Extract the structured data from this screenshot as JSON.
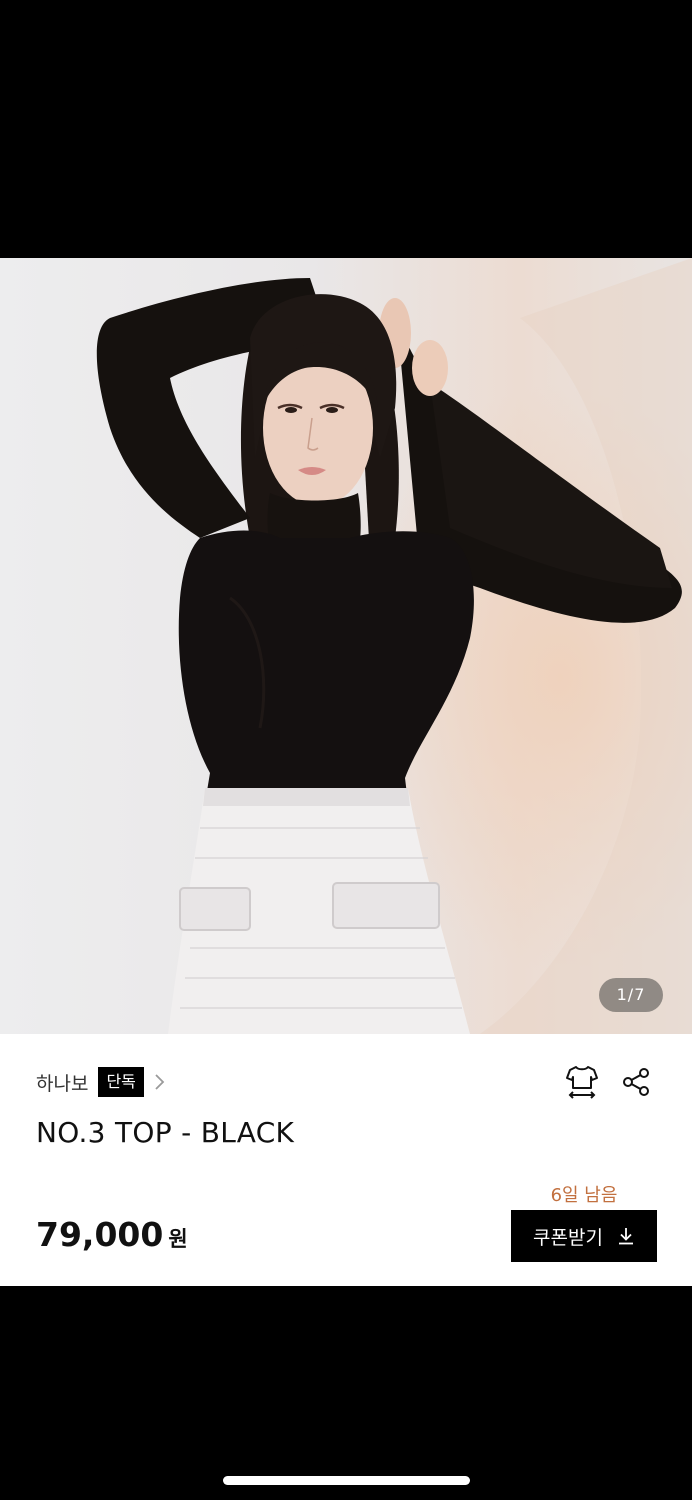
{
  "gallery": {
    "current_page": "1",
    "total_pages": "7",
    "separator": "/"
  },
  "product": {
    "brand": "하나보",
    "exclusive_badge": "단독",
    "title": "NO.3 TOP - BLACK",
    "price": "79,000",
    "price_unit": "원"
  },
  "coupon": {
    "days_left": "6일 남음",
    "button_label": "쿠폰받기"
  },
  "icons": {
    "brand_chevron": "chevron-right-icon",
    "size_guide": "shirt-size-icon",
    "share": "share-icon",
    "download": "download-icon"
  },
  "colors": {
    "background": "#000000",
    "panel": "#ffffff",
    "accent_days_left": "#c2703f",
    "badge": "#000000",
    "coupon_button": "#000000"
  }
}
